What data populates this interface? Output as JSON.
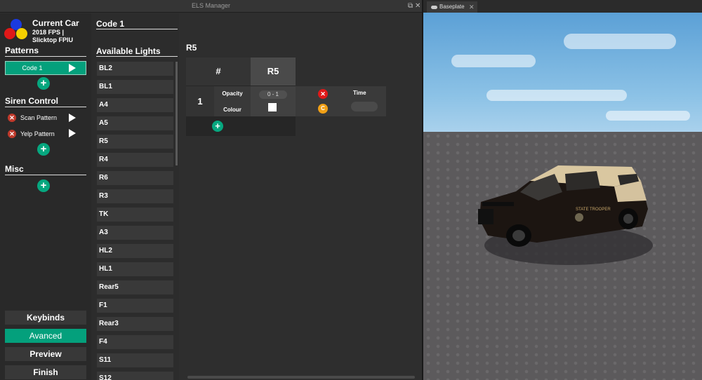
{
  "plugin": {
    "window_title": "ELS Manager",
    "current_car": {
      "title": "Current Car",
      "subtitle": "2018 FPS | Slicktop FPIU"
    },
    "patterns": {
      "heading": "Patterns",
      "items": [
        {
          "label": "Code 1"
        }
      ]
    },
    "siren_control": {
      "heading": "Siren Control",
      "items": [
        {
          "label": "Scan Pattern"
        },
        {
          "label": "Yelp Pattern"
        }
      ]
    },
    "misc": {
      "heading": "Misc"
    },
    "bottom_buttons": {
      "keybinds": "Keybinds",
      "advanced": "Avanced",
      "preview": "Preview",
      "finish": "Finish"
    },
    "middle": {
      "code_title": "Code 1",
      "available_heading": "Available Lights",
      "lights": [
        "BL2",
        "BL1",
        "A4",
        "A5",
        "R5",
        "R4",
        "R6",
        "R3",
        "TK",
        "A3",
        "HL2",
        "HL1",
        "Rear5",
        "F1",
        "Rear3",
        "F4",
        "S11",
        "S12"
      ]
    },
    "editor": {
      "heading": "R5",
      "col_hash": "#",
      "col_name": "R5",
      "row": {
        "number": "1",
        "opacity_label": "Opacity",
        "colour_label": "Colour",
        "range": "0 - 1",
        "time_label": "Time",
        "delete_glyph": "✕",
        "copy_glyph": "C"
      },
      "add_glyph": "+"
    },
    "colors": {
      "accent": "#04a07c",
      "delete": "#e01818",
      "copy": "#f1a016"
    }
  },
  "viewport": {
    "tab_label": "Baseplate",
    "car_text": "STATE TROOPER"
  }
}
